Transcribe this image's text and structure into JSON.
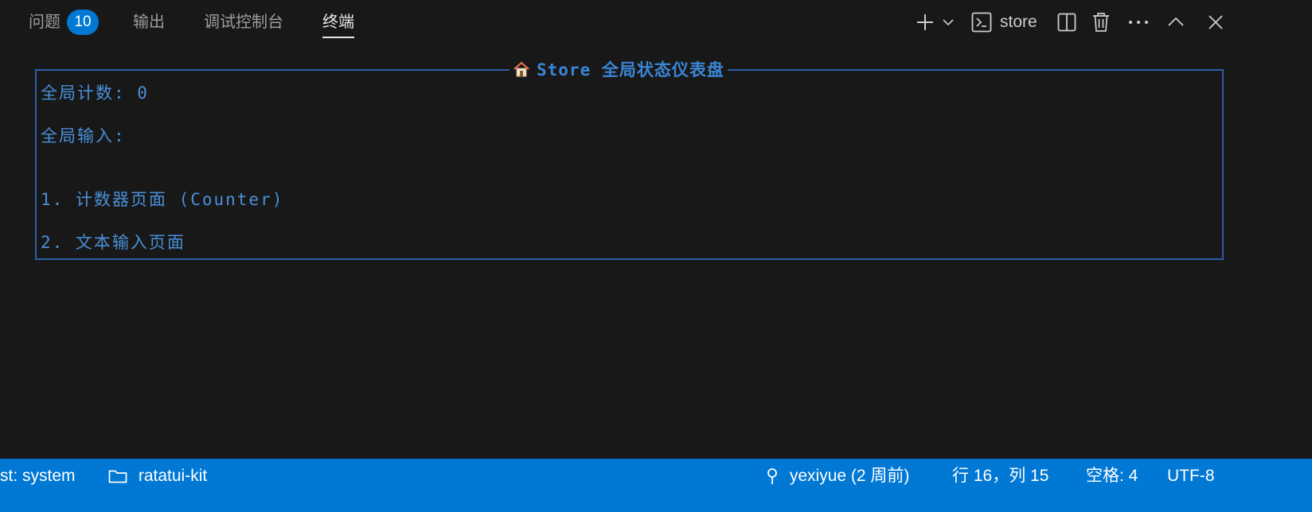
{
  "tabs": [
    {
      "label": "问题",
      "badge": "10"
    },
    {
      "label": "输出"
    },
    {
      "label": "调试控制台"
    },
    {
      "label": "终端",
      "active": true
    }
  ],
  "toolbar": {
    "terminal_name": "store",
    "icons": [
      "add-icon",
      "chevron-down-icon",
      "terminal-icon",
      "split-icon",
      "trash-icon",
      "more-icon",
      "chevron-up-icon",
      "close-icon"
    ]
  },
  "terminal": {
    "box_title": "Store 全局状态仪表盘",
    "title_icon": "house-icon",
    "lines": [
      "全局计数: 0",
      "全局输入:",
      "1. 计数器页面 (Counter)",
      "2. 文本输入页面"
    ]
  },
  "statusbar": {
    "left_partial": "st: system",
    "folder": "ratatui-kit",
    "git_blame": "yexiyue (2 周前)",
    "position": "行 16，列 15",
    "spaces": "空格: 4",
    "encoding": "UTF-8"
  },
  "colors": {
    "background": "#181818",
    "accent": "#0078d4",
    "terminal_text": "#4a8fd8",
    "box_border": "#2a5ea8"
  }
}
